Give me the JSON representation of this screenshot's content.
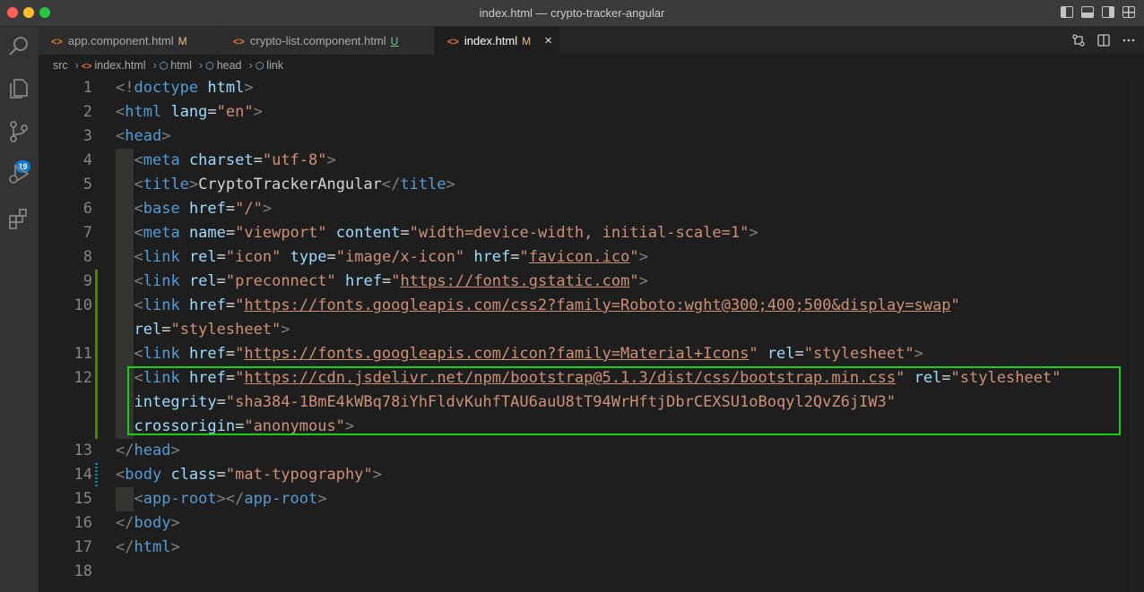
{
  "window": {
    "title": "index.html — crypto-tracker-angular"
  },
  "tabs": [
    {
      "icon": "<>",
      "label": "app.component.html",
      "status": "M"
    },
    {
      "icon": "<>",
      "label": "crypto-list.component.html",
      "status": "U"
    },
    {
      "icon": "<>",
      "label": "index.html",
      "status": "M",
      "close": "×"
    }
  ],
  "breadcrumb": {
    "items": [
      "src",
      "index.html",
      "html",
      "head",
      "link"
    ]
  },
  "activity": {
    "scm_badge": "19",
    "icons": [
      "explorer-icon",
      "search-icon",
      "source-control-icon",
      "run-debug-icon",
      "extensions-icon"
    ]
  },
  "editor": {
    "line_numbers": [
      "1",
      "2",
      "3",
      "4",
      "5",
      "6",
      "7",
      "8",
      "9",
      "10",
      "",
      "11",
      "12",
      "",
      "",
      "13",
      "14",
      "15",
      "16",
      "17",
      "18"
    ],
    "lines": [
      [
        [
          "p",
          "<!"
        ],
        [
          "t",
          "doctype"
        ],
        [
          "x",
          " "
        ],
        [
          "a",
          "html"
        ],
        [
          "p",
          ">"
        ]
      ],
      [
        [
          "p",
          "<"
        ],
        [
          "t",
          "html"
        ],
        [
          "x",
          " "
        ],
        [
          "a",
          "lang"
        ],
        [
          "x",
          "="
        ],
        [
          "s",
          "\"en\""
        ],
        [
          "p",
          ">"
        ]
      ],
      [
        [
          "p",
          "<"
        ],
        [
          "t",
          "head"
        ],
        [
          "p",
          ">"
        ]
      ],
      [
        [
          "x",
          "  "
        ],
        [
          "p",
          "<"
        ],
        [
          "t",
          "meta"
        ],
        [
          "x",
          " "
        ],
        [
          "a",
          "charset"
        ],
        [
          "x",
          "="
        ],
        [
          "s",
          "\"utf-8\""
        ],
        [
          "p",
          ">"
        ]
      ],
      [
        [
          "x",
          "  "
        ],
        [
          "p",
          "<"
        ],
        [
          "t",
          "title"
        ],
        [
          "p",
          ">"
        ],
        [
          "x",
          "CryptoTrackerAngular"
        ],
        [
          "p",
          "</"
        ],
        [
          "t",
          "title"
        ],
        [
          "p",
          ">"
        ]
      ],
      [
        [
          "x",
          "  "
        ],
        [
          "p",
          "<"
        ],
        [
          "t",
          "base"
        ],
        [
          "x",
          " "
        ],
        [
          "a",
          "href"
        ],
        [
          "x",
          "="
        ],
        [
          "s",
          "\"/\""
        ],
        [
          "p",
          ">"
        ]
      ],
      [
        [
          "x",
          "  "
        ],
        [
          "p",
          "<"
        ],
        [
          "t",
          "meta"
        ],
        [
          "x",
          " "
        ],
        [
          "a",
          "name"
        ],
        [
          "x",
          "="
        ],
        [
          "s",
          "\"viewport\""
        ],
        [
          "x",
          " "
        ],
        [
          "a",
          "content"
        ],
        [
          "x",
          "="
        ],
        [
          "s",
          "\"width=device-width, initial-scale=1\""
        ],
        [
          "p",
          ">"
        ]
      ],
      [
        [
          "x",
          "  "
        ],
        [
          "p",
          "<"
        ],
        [
          "t",
          "link"
        ],
        [
          "x",
          " "
        ],
        [
          "a",
          "rel"
        ],
        [
          "x",
          "="
        ],
        [
          "s",
          "\"icon\""
        ],
        [
          "x",
          " "
        ],
        [
          "a",
          "type"
        ],
        [
          "x",
          "="
        ],
        [
          "s",
          "\"image/x-icon\""
        ],
        [
          "x",
          " "
        ],
        [
          "a",
          "href"
        ],
        [
          "x",
          "="
        ],
        [
          "s",
          "\""
        ],
        [
          "u",
          "favicon.ico"
        ],
        [
          "s",
          "\""
        ],
        [
          "p",
          ">"
        ]
      ],
      [
        [
          "x",
          "  "
        ],
        [
          "p",
          "<"
        ],
        [
          "t",
          "link"
        ],
        [
          "x",
          " "
        ],
        [
          "a",
          "rel"
        ],
        [
          "x",
          "="
        ],
        [
          "s",
          "\"preconnect\""
        ],
        [
          "x",
          " "
        ],
        [
          "a",
          "href"
        ],
        [
          "x",
          "="
        ],
        [
          "s",
          "\""
        ],
        [
          "u",
          "https://fonts.gstatic.com"
        ],
        [
          "s",
          "\""
        ],
        [
          "p",
          ">"
        ]
      ],
      [
        [
          "x",
          "  "
        ],
        [
          "p",
          "<"
        ],
        [
          "t",
          "link"
        ],
        [
          "x",
          " "
        ],
        [
          "a",
          "href"
        ],
        [
          "x",
          "="
        ],
        [
          "s",
          "\""
        ],
        [
          "u",
          "https://fonts.googleapis.com/css2?family=Roboto:wght@300;400;500&display=swap"
        ],
        [
          "s",
          "\""
        ]
      ],
      [
        [
          "x",
          "  "
        ],
        [
          "a",
          "rel"
        ],
        [
          "x",
          "="
        ],
        [
          "s",
          "\"stylesheet\""
        ],
        [
          "p",
          ">"
        ]
      ],
      [
        [
          "x",
          "  "
        ],
        [
          "p",
          "<"
        ],
        [
          "t",
          "link"
        ],
        [
          "x",
          " "
        ],
        [
          "a",
          "href"
        ],
        [
          "x",
          "="
        ],
        [
          "s",
          "\""
        ],
        [
          "u",
          "https://fonts.googleapis.com/icon?family=Material+Icons"
        ],
        [
          "s",
          "\""
        ],
        [
          "x",
          " "
        ],
        [
          "a",
          "rel"
        ],
        [
          "x",
          "="
        ],
        [
          "s",
          "\"stylesheet\""
        ],
        [
          "p",
          ">"
        ]
      ],
      [
        [
          "x",
          "  "
        ],
        [
          "p",
          "<"
        ],
        [
          "t",
          "link"
        ],
        [
          "x",
          " "
        ],
        [
          "a",
          "href"
        ],
        [
          "x",
          "="
        ],
        [
          "s",
          "\""
        ],
        [
          "u",
          "https://cdn.jsdelivr.net/npm/bootstrap@5.1.3/dist/css/bootstrap.min.css"
        ],
        [
          "s",
          "\""
        ],
        [
          "x",
          " "
        ],
        [
          "a",
          "rel"
        ],
        [
          "x",
          "="
        ],
        [
          "s",
          "\"stylesheet\""
        ]
      ],
      [
        [
          "x",
          "  "
        ],
        [
          "a",
          "integrity"
        ],
        [
          "x",
          "="
        ],
        [
          "s",
          "\"sha384-1BmE4kWBq78iYhFldvKuhfTAU6auU8tT94WrHftjDbrCEXSU1oBoqyl2QvZ6jIW3\""
        ]
      ],
      [
        [
          "x",
          "  "
        ],
        [
          "a",
          "crossorigin"
        ],
        [
          "x",
          "="
        ],
        [
          "s",
          "\"anonymous\""
        ],
        [
          "p",
          ">"
        ]
      ],
      [
        [
          "p",
          "</"
        ],
        [
          "t",
          "head"
        ],
        [
          "p",
          ">"
        ]
      ],
      [
        [
          "p",
          "<"
        ],
        [
          "t",
          "body"
        ],
        [
          "x",
          " "
        ],
        [
          "a",
          "class"
        ],
        [
          "x",
          "="
        ],
        [
          "s",
          "\"mat-typography\""
        ],
        [
          "p",
          ">"
        ]
      ],
      [
        [
          "x",
          "  "
        ],
        [
          "p",
          "<"
        ],
        [
          "t",
          "app-root"
        ],
        [
          "p",
          ">"
        ],
        [
          "p",
          "</"
        ],
        [
          "t",
          "app-root"
        ],
        [
          "p",
          ">"
        ]
      ],
      [
        [
          "p",
          "</"
        ],
        [
          "t",
          "body"
        ],
        [
          "p",
          ">"
        ]
      ],
      [
        [
          "p",
          "</"
        ],
        [
          "t",
          "html"
        ],
        [
          "p",
          ">"
        ]
      ],
      []
    ]
  }
}
